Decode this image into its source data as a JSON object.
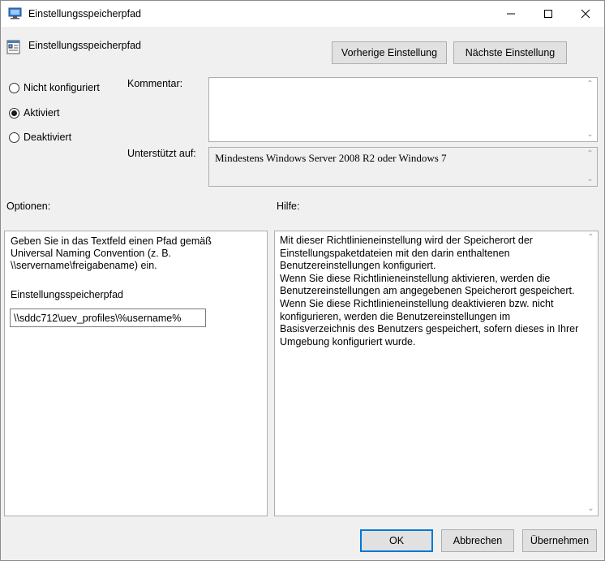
{
  "window": {
    "title": "Einstellungsspeicherpfad"
  },
  "header": {
    "setting_name": "Einstellungsspeicherpfad",
    "prev_label": "Vorherige Einstellung",
    "next_label": "Nächste Einstellung"
  },
  "state": {
    "options": [
      "Nicht konfiguriert",
      "Aktiviert",
      "Deaktiviert"
    ],
    "selected": "Aktiviert"
  },
  "comment": {
    "label": "Kommentar:",
    "value": ""
  },
  "supported": {
    "label": "Unterstützt auf:",
    "value": "Mindestens Windows Server 2008 R2 oder Windows 7"
  },
  "options_panel": {
    "label": "Optionen:",
    "description": "Geben Sie in das Textfeld einen Pfad gemäß Universal Naming Convention (z. B. \\\\servername\\freigabename) ein.",
    "field_label": "Einstellungsspeicherpfad",
    "field_value": "\\\\sddc712\\uev_profiles\\%username%"
  },
  "help_panel": {
    "label": "Hilfe:",
    "paragraphs": [
      "Mit dieser Richtlinieneinstellung wird der Speicherort der Einstellungspaketdateien mit den darin enthaltenen Benutzereinstellungen konfiguriert.",
      "Wenn Sie diese Richtlinieneinstellung aktivieren, werden die Benutzereinstellungen am angegebenen Speicherort gespeichert.",
      "Wenn Sie diese Richtlinieneinstellung deaktivieren bzw. nicht konfigurieren, werden die Benutzereinstellungen im Basisverzeichnis des Benutzers gespeichert, sofern dieses in Ihrer Umgebung konfiguriert wurde."
    ]
  },
  "footer": {
    "ok_label": "OK",
    "cancel_label": "Abbrechen",
    "apply_label": "Übernehmen"
  },
  "colors": {
    "accent": "#0078d7",
    "dialog_bg": "#f0f0f0"
  }
}
